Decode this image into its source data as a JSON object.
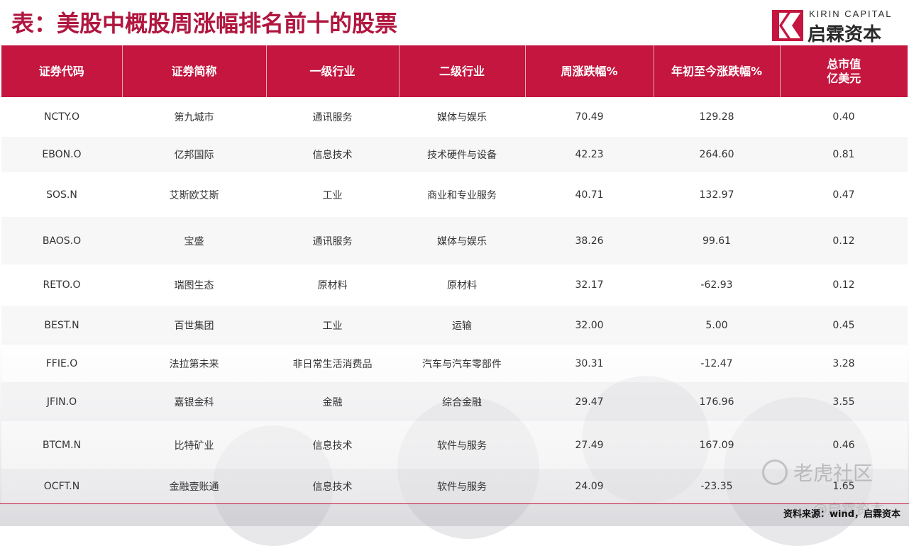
{
  "title": "表：美股中概股周涨幅排名前十的股票",
  "logo": {
    "en": "KIRIN CAPITAL",
    "cn": "启霖资本",
    "accent": "#c4163f"
  },
  "table": {
    "headers": [
      "证券代码",
      "证券简称",
      "一级行业",
      "二级行业",
      "周涨跌幅%",
      "年初至今涨跌幅%",
      [
        "总市值",
        "亿美元"
      ]
    ],
    "rows": [
      [
        "NCTY.O",
        "第九城市",
        "通讯服务",
        "媒体与娱乐",
        "70.49",
        "129.28",
        "0.40"
      ],
      [
        "EBON.O",
        "亿邦国际",
        "信息技术",
        "技术硬件与设备",
        "42.23",
        "264.60",
        "0.81"
      ],
      [
        "SOS.N",
        "艾斯欧艾斯",
        "工业",
        "商业和专业服务",
        "40.71",
        "132.97",
        "0.47"
      ],
      [
        "BAOS.O",
        "宝盛",
        "通讯服务",
        "媒体与娱乐",
        "38.26",
        "99.61",
        "0.12"
      ],
      [
        "RETO.O",
        "瑞图生态",
        "原材料",
        "原材料",
        "32.17",
        "-62.93",
        "0.12"
      ],
      [
        "BEST.N",
        "百世集团",
        "工业",
        "运输",
        "32.00",
        "5.00",
        "0.45"
      ],
      [
        "FFIE.O",
        "法拉第未来",
        "非日常生活消费品",
        "汽车与汽车零部件",
        "30.31",
        "-12.47",
        "3.28"
      ],
      [
        "JFIN.O",
        "嘉银金科",
        "金融",
        "综合金融",
        "29.47",
        "176.96",
        "3.55"
      ],
      [
        "BTCM.N",
        "比特矿业",
        "信息技术",
        "软件与服务",
        "27.49",
        "167.09",
        "0.46"
      ],
      [
        "OCFT.N",
        "金融壹账通",
        "信息技术",
        "软件与服务",
        "24.09",
        "-23.35",
        "1.65"
      ]
    ]
  },
  "source": "资料来源：wind，启霖资本",
  "watermark": {
    "main": "老虎社区",
    "sub": "@启霖资本"
  },
  "colors": {
    "header_bg": "#c4163f",
    "title": "#b0163e"
  }
}
